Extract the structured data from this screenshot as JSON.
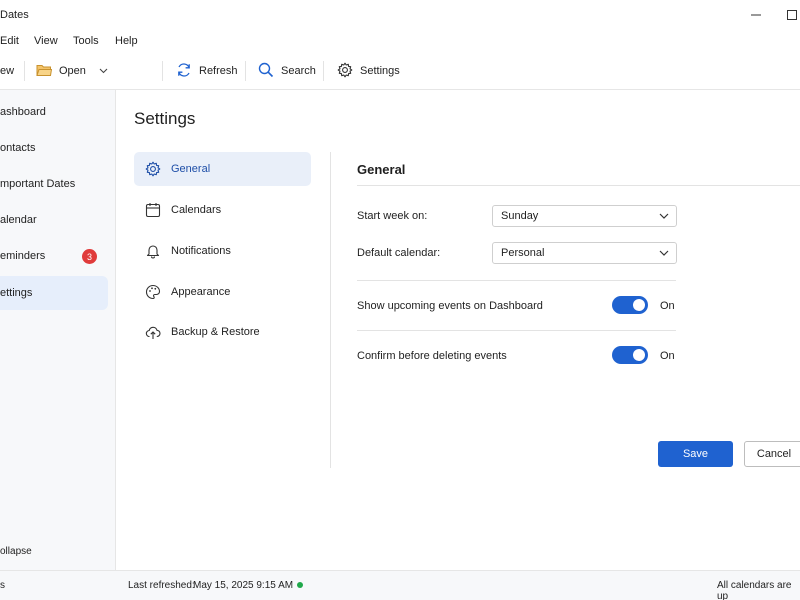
{
  "window": {
    "title": "Dates"
  },
  "menu": [
    "Edit",
    "View",
    "Tools",
    "Help"
  ],
  "toolbar": {
    "new_label": "ew",
    "open_label": "Open",
    "refresh_label": "Refresh",
    "search_label": "Search",
    "settings_label": "Settings"
  },
  "sidebar": {
    "items": [
      {
        "label": "ashboard"
      },
      {
        "label": "ontacts"
      },
      {
        "label": "mportant Dates"
      },
      {
        "label": "alendar"
      },
      {
        "label": "eminders",
        "badge": "3"
      },
      {
        "label": "ettings"
      }
    ],
    "collapse_label": "ollapse"
  },
  "page": {
    "title": "Settings"
  },
  "categories": [
    {
      "label": "General",
      "icon": "gear-icon"
    },
    {
      "label": "Calendars",
      "icon": "calendar-icon"
    },
    {
      "label": "Notifications",
      "icon": "bell-icon"
    },
    {
      "label": "Appearance",
      "icon": "palette-icon"
    },
    {
      "label": "Backup & Restore",
      "icon": "cloud-upload-icon"
    }
  ],
  "general": {
    "title": "General",
    "start_week_label": "Start week on:",
    "start_week_value": "Sunday",
    "default_calendar_label": "Default calendar:",
    "default_calendar_value": "Personal",
    "show_upcoming_label": "Show upcoming events on Dashboard",
    "show_upcoming_state": "On",
    "confirm_delete_label": "Confirm before deleting events",
    "confirm_delete_state": "On"
  },
  "actions": {
    "save": "Save",
    "cancel": "Cancel"
  },
  "status": {
    "left": "s",
    "last_refreshed_label": "Last refreshed:",
    "last_refreshed_value": "May 15, 2025 9:15 AM",
    "right": "All calendars are up"
  },
  "colors": {
    "accent": "#1f62d0",
    "badge": "#e03b3b",
    "online": "#1fa84a"
  }
}
